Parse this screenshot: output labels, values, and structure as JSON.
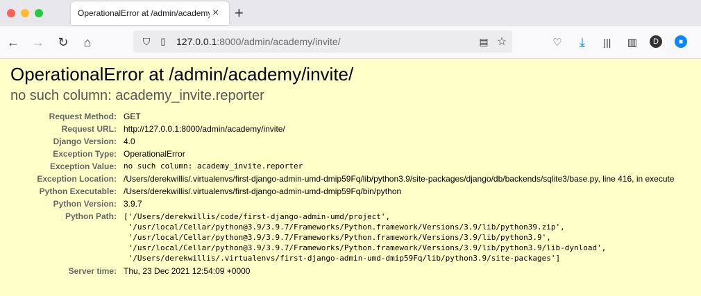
{
  "browser": {
    "tab_title": "OperationalError at /admin/academy/invite/",
    "url_host": "127.0.0.1",
    "url_rest": ":8000/admin/academy/invite/",
    "profile_initial": "D"
  },
  "page": {
    "title": "OperationalError at /admin/academy/invite/",
    "subtitle": "no such column: academy_invite.reporter",
    "rows": [
      {
        "label": "Request Method:",
        "value": "GET"
      },
      {
        "label": "Request URL:",
        "value": "http://127.0.0.1:8000/admin/academy/invite/"
      },
      {
        "label": "Django Version:",
        "value": "4.0"
      },
      {
        "label": "Exception Type:",
        "value": "OperationalError"
      },
      {
        "label": "Exception Value:",
        "value": "no such column: academy_invite.reporter"
      },
      {
        "label": "Exception Location:",
        "value": "/Users/derekwillis/.virtualenvs/first-django-admin-umd-dmip59Fq/lib/python3.9/site-packages/django/db/backends/sqlite3/base.py, line 416, in execute"
      },
      {
        "label": "Python Executable:",
        "value": "/Users/derekwillis/.virtualenvs/first-django-admin-umd-dmip59Fq/bin/python"
      },
      {
        "label": "Python Version:",
        "value": "3.9.7"
      },
      {
        "label": "Python Path:",
        "value": ""
      },
      {
        "label": "Server time:",
        "value": "Thu, 23 Dec 2021 12:54:09 +0000"
      }
    ],
    "python_path": [
      "['/Users/derekwillis/code/first-django-admin-umd/project',",
      " '/usr/local/Cellar/python@3.9/3.9.7/Frameworks/Python.framework/Versions/3.9/lib/python39.zip',",
      " '/usr/local/Cellar/python@3.9/3.9.7/Frameworks/Python.framework/Versions/3.9/lib/python3.9',",
      " '/usr/local/Cellar/python@3.9/3.9.7/Frameworks/Python.framework/Versions/3.9/lib/python3.9/lib-dynload',",
      " '/Users/derekwillis/.virtualenvs/first-django-admin-umd-dmip59Fq/lib/python3.9/site-packages']"
    ]
  }
}
